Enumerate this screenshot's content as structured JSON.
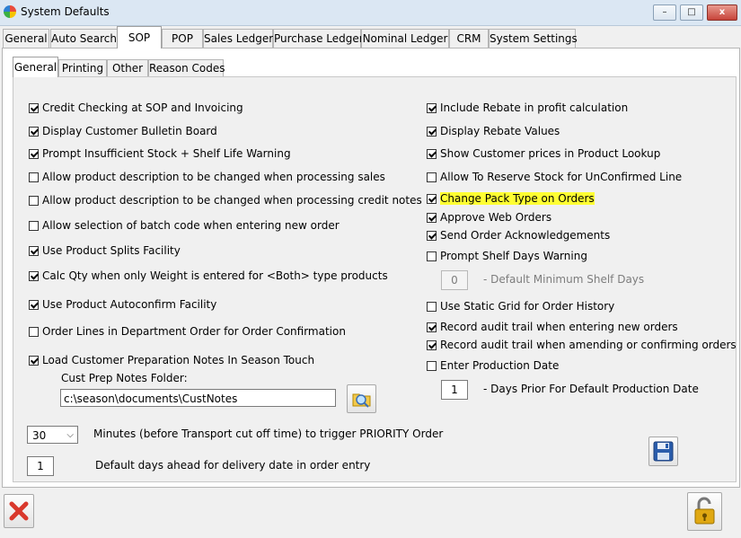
{
  "window": {
    "title": "System Defaults",
    "minimize": "–",
    "maximize": "□",
    "close": "x"
  },
  "tabs": [
    "General",
    "Auto Search",
    "SOP",
    "POP",
    "Sales Ledger",
    "Purchase Ledger",
    "Nominal Ledger",
    "CRM",
    "System Settings"
  ],
  "subtabs": [
    "General",
    "Printing",
    "Other",
    "Reason Codes"
  ],
  "left": {
    "credit_check": "Credit Checking at SOP and Invoicing",
    "bulletin": "Display Customer Bulletin Board",
    "insufficient": "Prompt Insufficient Stock + Shelf Life Warning",
    "desc_sales": "Allow product description to be changed when processing sales",
    "desc_credit": "Allow product description to be changed when processing credit notes",
    "batch": "Allow selection of batch code when entering new order",
    "splits": "Use Product Splits Facility",
    "calc_qty": "Calc Qty when only Weight is entered for <Both> type products",
    "autoconfirm": "Use Product Autoconfirm Facility",
    "dept_order": "Order Lines in Department Order for Order Confirmation",
    "prep_notes": "Load Customer Preparation Notes In Season Touch",
    "folder_label": "Cust Prep Notes Folder:",
    "folder_value": "c:\\season\\documents\\CustNotes",
    "minutes_value": "30",
    "minutes_label": "Minutes (before Transport cut off time) to trigger  PRIORITY Order",
    "days_value": "1",
    "days_label": "Default days ahead for delivery date in order entry"
  },
  "right": {
    "rebate_profit": "Include Rebate in profit calculation",
    "rebate_values": "Display Rebate Values",
    "cust_prices": "Show Customer prices in Product Lookup",
    "reserve": "Allow To Reserve Stock for UnConfirmed Line",
    "pack_type": "Change Pack Type on Orders",
    "web_orders": "Approve Web Orders",
    "acks": "Send Order Acknowledgements",
    "shelf_warn": "Prompt Shelf Days Warning",
    "shelf_value": "0",
    "shelf_label": "- Default Minimum Shelf Days",
    "static_grid": "Use Static Grid for Order History",
    "audit_new": "Record audit trail when entering new orders",
    "audit_amend": "Record audit trail when amending or confirming orders",
    "prod_date": "Enter Production Date",
    "prior_value": "1",
    "prior_label": "- Days Prior For Default Production Date"
  },
  "colors": {
    "highlight": "#ffff33",
    "close_red": "#d9382c",
    "save_blue": "#2b5dab",
    "lock_gold": "#e0a812"
  }
}
